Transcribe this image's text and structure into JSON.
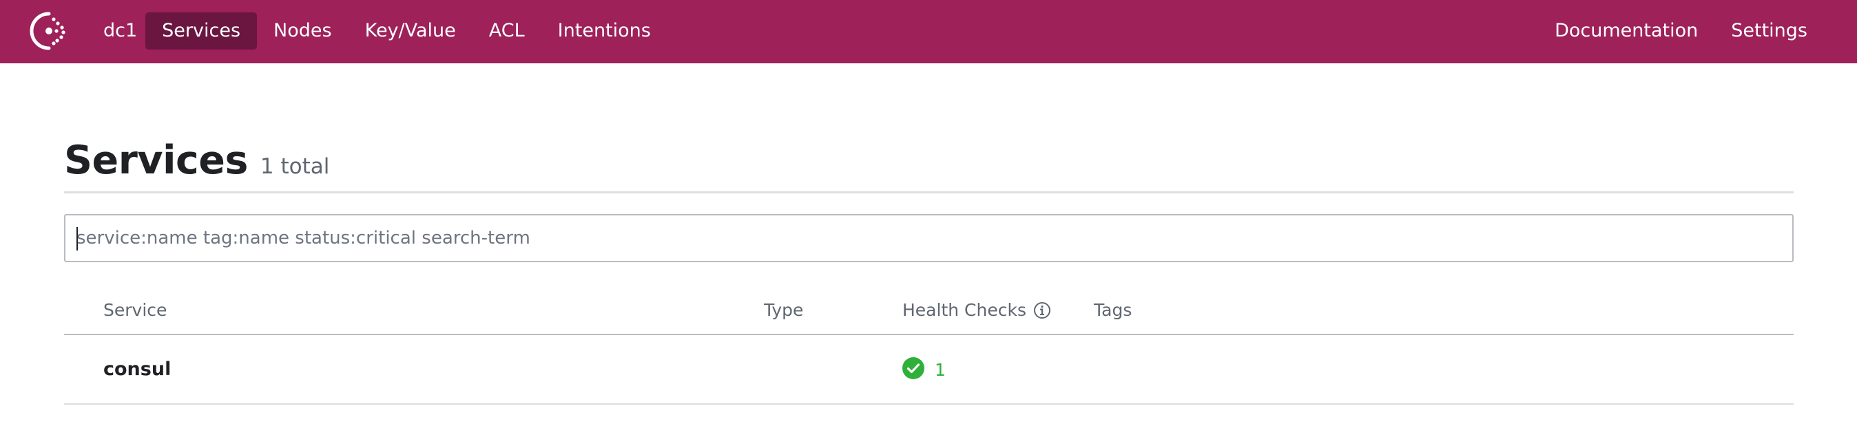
{
  "nav": {
    "logo_icon": "consul-logo-icon",
    "datacenter": "dc1",
    "items": [
      {
        "label": "Services",
        "active": true
      },
      {
        "label": "Nodes",
        "active": false
      },
      {
        "label": "Key/Value",
        "active": false
      },
      {
        "label": "ACL",
        "active": false
      },
      {
        "label": "Intentions",
        "active": false
      }
    ],
    "right_items": [
      {
        "label": "Documentation"
      },
      {
        "label": "Settings"
      }
    ],
    "brand_color": "#9e2159",
    "active_color": "#6a1640"
  },
  "page": {
    "title": "Services",
    "total": "1 total"
  },
  "search": {
    "placeholder": "service:name tag:name status:critical search-term",
    "value": ""
  },
  "table": {
    "headers": {
      "service": "Service",
      "type": "Type",
      "health_checks": "Health Checks",
      "tags": "Tags"
    },
    "header_icon": "info-icon",
    "rows": [
      {
        "service": "consul",
        "type": "",
        "health_passing": "1",
        "health_icon": "check-circle-icon",
        "tags": ""
      }
    ]
  },
  "colors": {
    "passing": "#2eb039"
  }
}
